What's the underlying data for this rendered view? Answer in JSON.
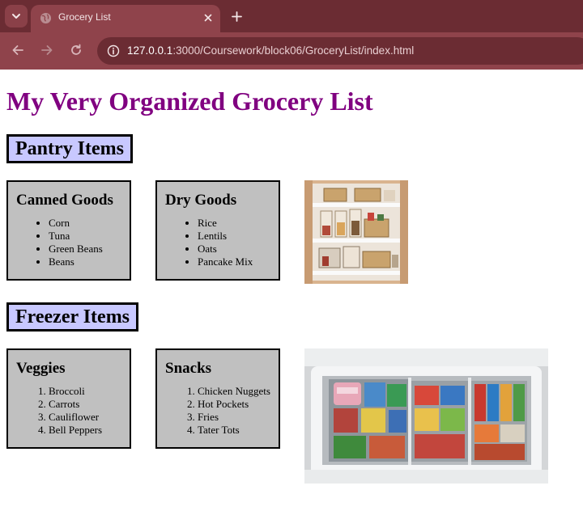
{
  "browser": {
    "tab_title": "Grocery List",
    "url_host": "127.0.0.1",
    "url_rest": ":3000/Coursework/block06/GroceryList/index.html"
  },
  "page": {
    "title": "My Very Organized Grocery List",
    "sections": [
      {
        "heading": "Pantry Items",
        "cards": [
          {
            "title": "Canned Goods",
            "items": [
              "Corn",
              "Tuna",
              "Green Beans",
              "Beans"
            ]
          },
          {
            "title": "Dry Goods",
            "items": [
              "Rice",
              "Lentils",
              "Oats",
              "Pancake Mix"
            ]
          }
        ]
      },
      {
        "heading": "Freezer Items",
        "cards": [
          {
            "title": "Veggies",
            "items": [
              "Broccoli",
              "Carrots",
              "Cauliflower",
              "Bell Peppers"
            ]
          },
          {
            "title": "Snacks",
            "items": [
              "Chicken Nuggets",
              "Hot Pockets",
              "Fries",
              "Tater Tots"
            ]
          }
        ]
      }
    ]
  },
  "colors": {
    "title": "#800080",
    "heading_bg": "#c8c8ff",
    "card_bg": "#c0c0c0",
    "chrome_dark": "#6b2c33",
    "chrome_light": "#8f434b"
  },
  "icons": [
    "tab-search-icon",
    "globe-favicon-icon",
    "close-icon",
    "plus-icon",
    "back-arrow-icon",
    "forward-arrow-icon",
    "reload-icon",
    "site-info-icon"
  ]
}
